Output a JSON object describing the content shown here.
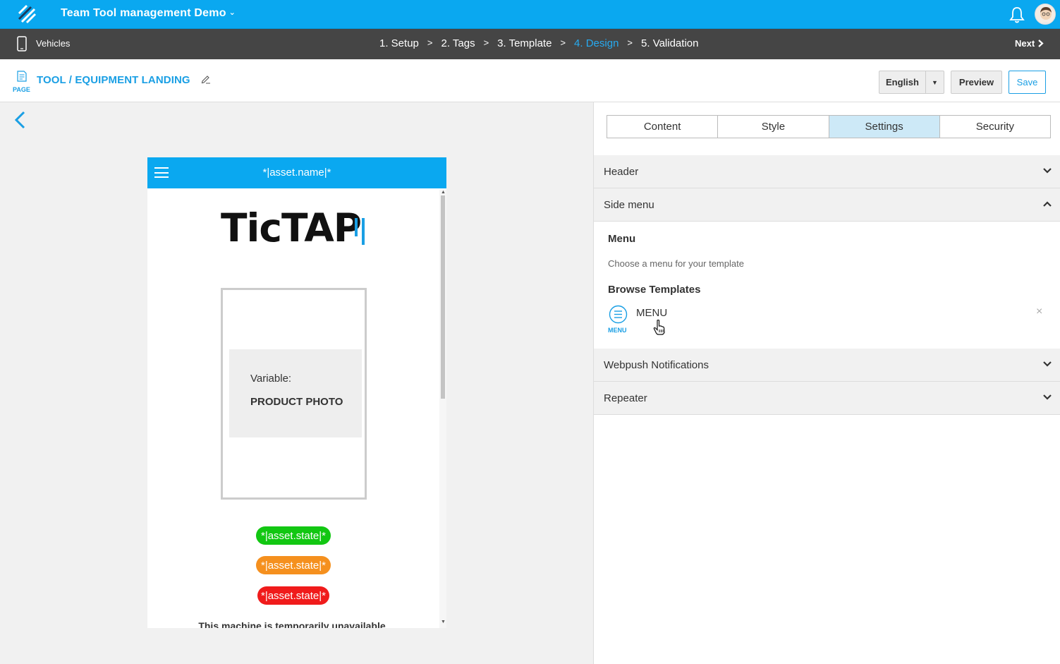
{
  "app": {
    "title": "Team Tool management Demo",
    "accent": "#0aa8f0"
  },
  "steps_bar": {
    "section": "Vehicles",
    "steps": [
      "1. Setup",
      "2. Tags",
      "3. Template",
      "4. Design",
      "5. Validation"
    ],
    "active_step": "4. Design",
    "separator": ">",
    "next_label": "Next"
  },
  "page_header": {
    "type_label": "PAGE",
    "title": "TOOL / EQUIPMENT LANDING",
    "language": "English",
    "preview_label": "Preview",
    "save_label": "Save"
  },
  "preview": {
    "header_title": "*|asset.name|*",
    "brand": "TicTAP",
    "variable_label": "Variable:",
    "variable_name": "PRODUCT PHOTO",
    "states": [
      {
        "label": "*|asset.state|*",
        "color": "#12c712"
      },
      {
        "label": "*|asset.state|*",
        "color": "#f5901e"
      },
      {
        "label": "*|asset.state|*",
        "color": "#f01b1b"
      }
    ],
    "footer_text": "This machine is temporarily unavailable"
  },
  "panel": {
    "tabs": [
      "Content",
      "Style",
      "Settings",
      "Security"
    ],
    "active_tab": "Settings",
    "sections": {
      "header": "Header",
      "side_menu": "Side menu",
      "webpush": "Webpush Notifications",
      "repeater": "Repeater"
    },
    "menu": {
      "title": "Menu",
      "description": "Choose a menu for your template",
      "browse_label": "Browse Templates",
      "selected_name": "MENU",
      "selected_icon_label": "MENU",
      "remove_symbol": "×"
    }
  }
}
